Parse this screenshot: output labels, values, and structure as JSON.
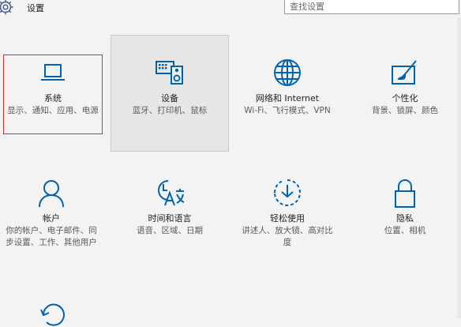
{
  "app": {
    "title": "设置",
    "icon": "gear-icon"
  },
  "search": {
    "placeholder": "查找设置",
    "value": ""
  },
  "colors": {
    "accent": "#0063b1",
    "selection_border": "#e0282a"
  },
  "tiles": [
    {
      "key": "system",
      "label": "系统",
      "desc": "显示、通知、应用、电源",
      "icon": "laptop-icon"
    },
    {
      "key": "devices",
      "label": "设备",
      "desc": "蓝牙、打印机、鼠标",
      "icon": "keyboard-speaker-icon"
    },
    {
      "key": "network",
      "label": "网络和 Internet",
      "desc": "Wi-Fi、飞行模式、VPN",
      "icon": "globe-icon"
    },
    {
      "key": "personalization",
      "label": "个性化",
      "desc": "背景、锁屏、颜色",
      "icon": "paint-brush-icon"
    },
    {
      "key": "accounts",
      "label": "帐户",
      "desc": "你的帐户、电子邮件、同步设置、工作、其他用户",
      "icon": "person-icon"
    },
    {
      "key": "time-language",
      "label": "时间和语言",
      "desc": "语音、区域、日期",
      "icon": "time-language-icon"
    },
    {
      "key": "ease-of-access",
      "label": "轻松使用",
      "desc": "讲述人、放大镜、高对比度",
      "icon": "ease-of-access-icon"
    },
    {
      "key": "privacy",
      "label": "隐私",
      "desc": "位置、相机",
      "icon": "lock-icon"
    },
    {
      "key": "update-security",
      "icon": "update-icon"
    }
  ]
}
